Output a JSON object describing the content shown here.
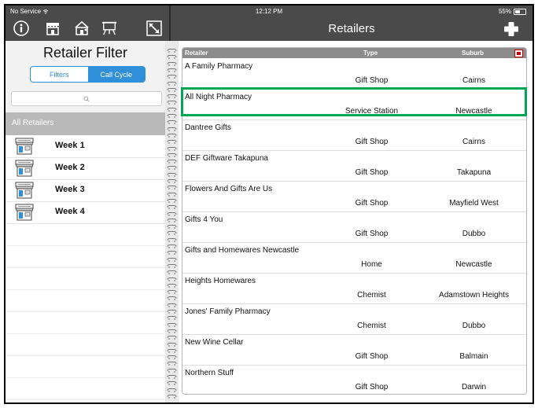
{
  "status_bar": {
    "carrier": "No Service",
    "time": "12:12 PM",
    "battery": "55%"
  },
  "toolbar": {
    "icons": [
      "info-icon",
      "store-icon",
      "map-store-icon",
      "easel-icon",
      "resize-icon"
    ],
    "title": "Retailers",
    "add_icon": "plus-icon"
  },
  "filter_panel": {
    "title": "Retailer Filter",
    "segments": [
      {
        "label": "Filters",
        "active": false
      },
      {
        "label": "Call Cycle",
        "active": true
      }
    ],
    "search_placeholder": "",
    "all_retailers_label": "All Retailers",
    "weeks": [
      {
        "label": "Week 1",
        "icon": "store-icon"
      },
      {
        "label": "Week 2",
        "icon": "store-icon"
      },
      {
        "label": "Week 3",
        "icon": "store-icon"
      },
      {
        "label": "Week 4",
        "icon": "store-icon"
      }
    ]
  },
  "table": {
    "columns": {
      "retailer": "Retailer",
      "type": "Type",
      "suburb": "Suburb"
    },
    "rows": [
      {
        "retailer": "A Family Pharmacy",
        "type": "Gift Shop",
        "suburb": "Cairns",
        "highlighted": false
      },
      {
        "retailer": "All Night Pharmacy",
        "type": "Service Station",
        "suburb": "Newcastle",
        "highlighted": true
      },
      {
        "retailer": "Dantree Gifts",
        "type": "Gift Shop",
        "suburb": "Cairns",
        "highlighted": false
      },
      {
        "retailer": "DEF Giftware Takapuna",
        "type": "Gift Shop",
        "suburb": "Takapuna",
        "highlighted": false
      },
      {
        "retailer": "Flowers And Gifts Are Us",
        "type": "Gift Shop",
        "suburb": "Mayfield West",
        "highlighted": false
      },
      {
        "retailer": "Gifts 4 You",
        "type": "Gift Shop",
        "suburb": "Dubbo",
        "highlighted": false
      },
      {
        "retailer": "Gifts and Homewares Newcastle",
        "type": "Home",
        "suburb": "Newcastle",
        "highlighted": false
      },
      {
        "retailer": "Heights Homewares",
        "type": "Chemist",
        "suburb": "Adamstown Heights",
        "highlighted": false
      },
      {
        "retailer": "Jones' Family Pharmacy",
        "type": "Chemist",
        "suburb": "Dubbo",
        "highlighted": false
      },
      {
        "retailer": "New Wine Cellar",
        "type": "Gift Shop",
        "suburb": "Balmain",
        "highlighted": false
      },
      {
        "retailer": "Northern Stuff",
        "type": "Gift Shop",
        "suburb": "Darwin",
        "highlighted": false
      }
    ]
  },
  "colors": {
    "toolbar_bg": "#4a4a4a",
    "accent_blue": "#2f8fd8",
    "highlight_green": "#00a651",
    "header_gray": "#8c8c8c"
  }
}
